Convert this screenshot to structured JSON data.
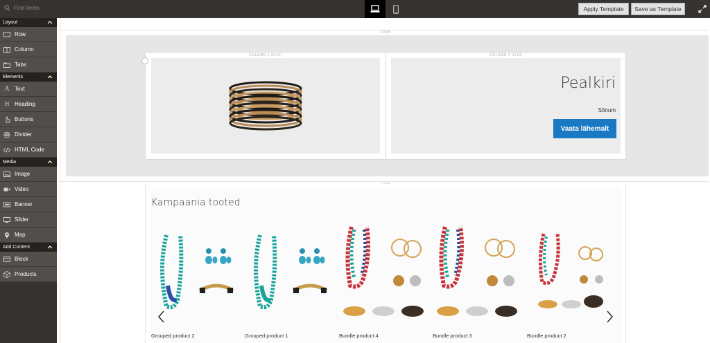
{
  "topbar": {
    "search_placeholder": "Find items",
    "apply_label": "Apply Template",
    "save_label": "Save as Template"
  },
  "sidebar": {
    "sections": [
      {
        "label": "Layout",
        "items": [
          "Row",
          "Column",
          "Tabs"
        ]
      },
      {
        "label": "Elements",
        "items": [
          "Text",
          "Heading",
          "Buttons",
          "Divider",
          "HTML Code"
        ]
      },
      {
        "label": "Media",
        "items": [
          "Image",
          "Video",
          "Banner",
          "Slider",
          "Map"
        ]
      },
      {
        "label": "Add Content",
        "items": [
          "Block",
          "Products"
        ]
      }
    ]
  },
  "stage": {
    "row_label_1": "ROW",
    "column1_label": "COLUMN 1 (6/12)",
    "column2_label": "COLUMN 2 (6/12)",
    "heading": "Pealkiri",
    "message": "Sõnum",
    "button": "Vaata lähemalt",
    "row_label_2": "ROW",
    "products_title": "Kampaania tooted",
    "products": [
      "Grouped product 2",
      "Grouped product 1",
      "Bundle product 4",
      "Bundle product 3",
      "Bundle product 2"
    ]
  },
  "colors": {
    "accent": "#1979c3",
    "sidebar": "#373330",
    "sidebar_item": "#514e4b"
  }
}
